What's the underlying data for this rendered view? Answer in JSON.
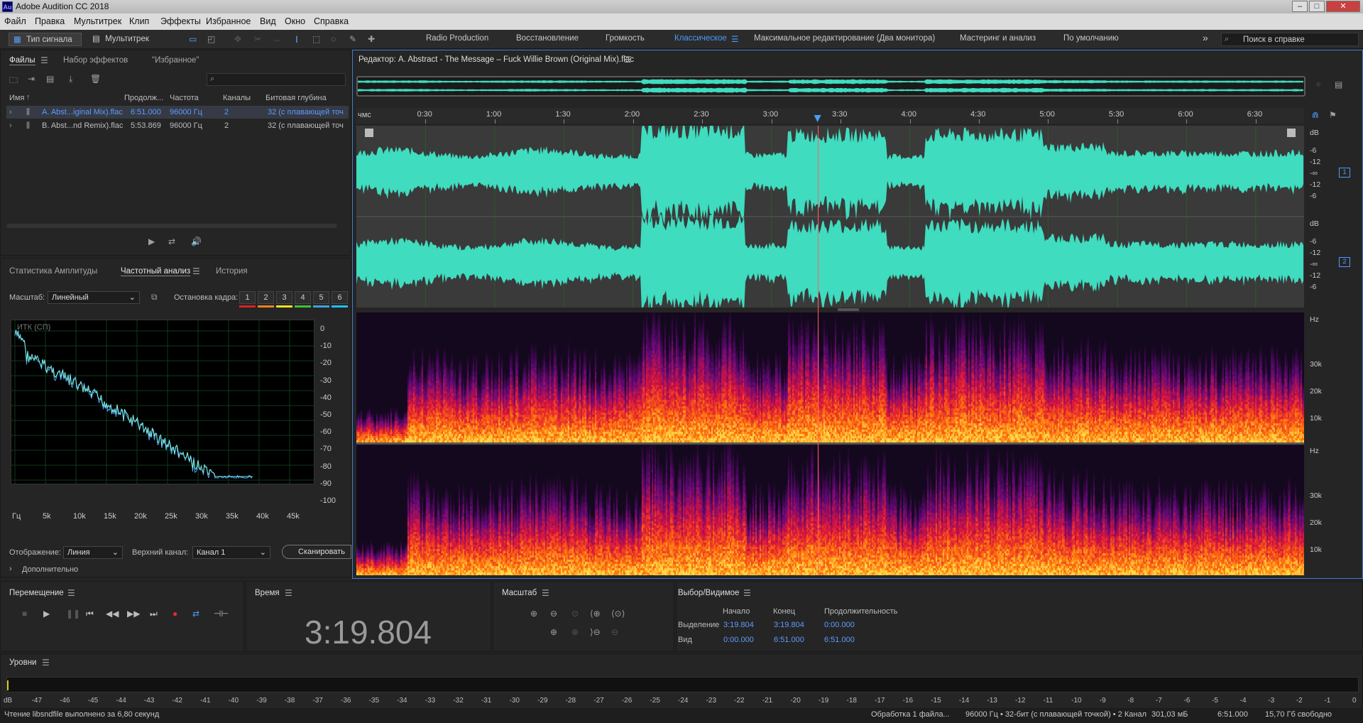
{
  "app": {
    "title": "Adobe Audition CC 2018",
    "logo": "Au"
  },
  "window_controls": {
    "minimize": "–",
    "restore": "□",
    "close": "✕"
  },
  "menu": [
    "Файл",
    "Правка",
    "Мультитрек",
    "Клип",
    "Эффекты",
    "Избранное",
    "Вид",
    "Окно",
    "Справка"
  ],
  "toolbar": {
    "waveform_label": "Тип сигнала",
    "multitrack_label": "Мультитрек",
    "search_placeholder": "Поиск в справке",
    "more": "»"
  },
  "workspaces": [
    {
      "label": "Radio Production",
      "active": false
    },
    {
      "label": "Восстановление",
      "active": false
    },
    {
      "label": "Громкость",
      "active": false
    },
    {
      "label": "Классическое",
      "active": true
    },
    {
      "label": "Максимальное редактирование (Два монитора)",
      "active": false
    },
    {
      "label": "Мастеринг и анализ",
      "active": false
    },
    {
      "label": "По умолчанию",
      "active": false
    }
  ],
  "files_panel": {
    "tabs": [
      "Файлы",
      "Набор эффектов",
      "\"Избранное\""
    ],
    "columns": [
      "Имя",
      "Продолж...",
      "Частота",
      "Каналы",
      "Битовая глубина"
    ],
    "sort_arrow": "↑",
    "rows": [
      {
        "name": "A. Abst...iginal Mix).flac",
        "duration": "6:51.000",
        "rate": "96000 Гц",
        "channels": "2",
        "depth": "32 (с плавающей точ",
        "selected": true
      },
      {
        "name": "B. Abst...nd Remix).flac",
        "duration": "5:53.869",
        "rate": "96000 Гц",
        "channels": "2",
        "depth": "32 (с плавающей точ",
        "selected": false
      }
    ]
  },
  "analysis_panel": {
    "tabs": [
      "Статистика Амплитуды",
      "Частотный анализ",
      "История"
    ],
    "scale_label": "Масштаб:",
    "scale_value": "Линейный",
    "freeze_label": "Остановка кадра:",
    "frames": [
      "1",
      "2",
      "3",
      "4",
      "5",
      "6"
    ],
    "frame_colors": [
      "#e02020",
      "#f08020",
      "#f0e020",
      "#40c040",
      "#40a0e0",
      "#20c0f0"
    ],
    "graph_label": "ИТК (СП)",
    "db_ticks": [
      "0",
      "-10",
      "-20",
      "-30",
      "-40",
      "-50",
      "-60",
      "-70",
      "-80",
      "-90",
      "-100"
    ],
    "freq_ticks": [
      "Гц",
      "5k",
      "10k",
      "15k",
      "20k",
      "25k",
      "30k",
      "35k",
      "40k",
      "45k"
    ],
    "display_label": "Отображение:",
    "display_value": "Линия",
    "channel_label": "Верхний канал:",
    "channel_value": "Канал 1",
    "scan_button": "Сканировать",
    "advanced": "Дополнительно"
  },
  "editor": {
    "title": "Редактор: A. Abstract - The Message – Fuck Willie Brown (Original Mix).flac",
    "ruler_unit": "чмс",
    "ruler_ticks": [
      "0:30",
      "1:00",
      "1:30",
      "2:00",
      "2:30",
      "3:00",
      "3:30",
      "4:00",
      "4:30",
      "5:00",
      "5:30",
      "6:00",
      "6:30"
    ],
    "db_labels": [
      "dB",
      "-6",
      "-12",
      "-∞",
      "-12",
      "-6"
    ],
    "hz_label": "Hz",
    "hz_ticks": [
      "30k",
      "20k",
      "10k"
    ],
    "channel_badges": [
      "1",
      "2"
    ],
    "playhead_fraction": 0.4866,
    "wave_color": "#3fdcbf"
  },
  "transport": {
    "title": "Перемещение"
  },
  "time": {
    "title": "Время",
    "value": "3:19.804"
  },
  "zoom": {
    "title": "Масштаб"
  },
  "selection": {
    "title": "Выбор/Видимое",
    "col_start": "Начало",
    "col_end": "Конец",
    "col_dur": "Продолжительность",
    "row1_label": "Выделение",
    "row1": [
      "3:19.804",
      "3:19.804",
      "0:00.000"
    ],
    "row2_label": "Вид",
    "row2": [
      "0:00.000",
      "6:51.000",
      "6:51.000"
    ]
  },
  "levels": {
    "title": "Уровни",
    "scale": [
      "dB",
      "-47",
      "-46",
      "-45",
      "-44",
      "-43",
      "-42",
      "-41",
      "-40",
      "-39",
      "-38",
      "-37",
      "-36",
      "-35",
      "-34",
      "-33",
      "-32",
      "-31",
      "-30",
      "-29",
      "-28",
      "-27",
      "-26",
      "-25",
      "-24",
      "-23",
      "-22",
      "-21",
      "-20",
      "-19",
      "-18",
      "-17",
      "-16",
      "-15",
      "-14",
      "-13",
      "-12",
      "-11",
      "-10",
      "-9",
      "-8",
      "-7",
      "-6",
      "-5",
      "-4",
      "-3",
      "-2",
      "-1",
      "0"
    ]
  },
  "status": {
    "left": "Чтение libsndfile выполнено за 6,80 секунд",
    "processing": "Обработка 1 файла...",
    "format": "96000 Гц • 32-бит (с плавающей точкой) • 2 Канал",
    "size": "301,03 мБ",
    "duration": "6:51.000",
    "free": "15,70 Гб свободно"
  }
}
